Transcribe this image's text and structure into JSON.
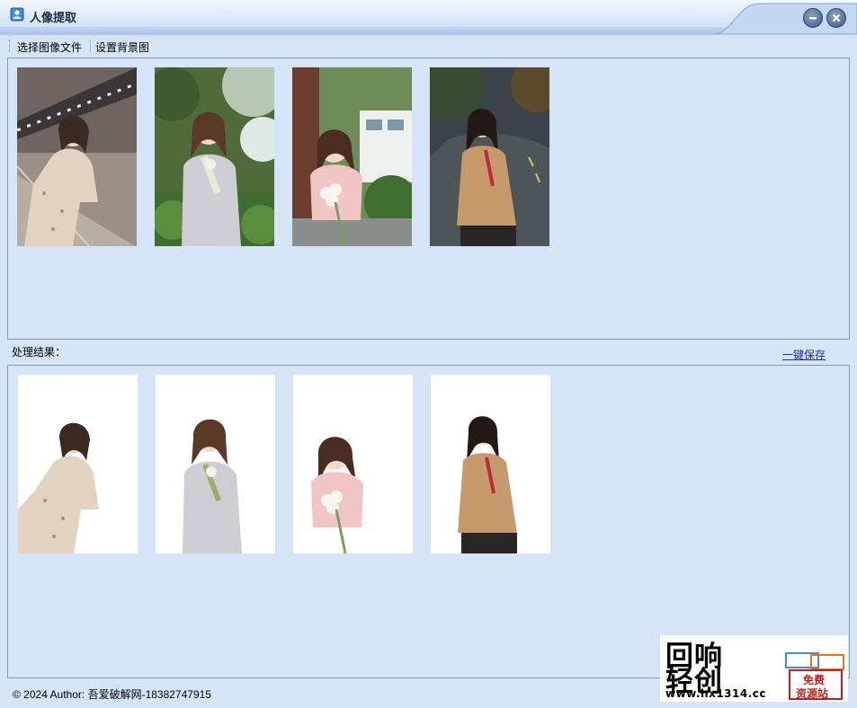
{
  "window": {
    "title": "人像提取",
    "icon": "portrait-app-icon"
  },
  "toolbar": {
    "select_image": "选择图像文件",
    "set_background": "设置背景图"
  },
  "source_images": [
    {
      "name": "source-photo-1"
    },
    {
      "name": "source-photo-2"
    },
    {
      "name": "source-photo-3"
    },
    {
      "name": "source-photo-4"
    }
  ],
  "results": {
    "label": "处理结果：",
    "save_all": "一键保存",
    "images": [
      {
        "name": "result-photo-1"
      },
      {
        "name": "result-photo-2"
      },
      {
        "name": "result-photo-3"
      },
      {
        "name": "result-photo-4"
      }
    ]
  },
  "status": {
    "text": "© 2024 Author: 吾爱破解网-18382747915"
  },
  "watermark": {
    "line1": "回响",
    "line2": "轻创",
    "url": "www.hx1314.cc",
    "badge_top": "免费",
    "badge_bottom": "资源站"
  },
  "colors": {
    "background": "#d6e4f8",
    "border": "#8598b7",
    "link": "#1a2fb3",
    "badge": "#c21d1d"
  }
}
